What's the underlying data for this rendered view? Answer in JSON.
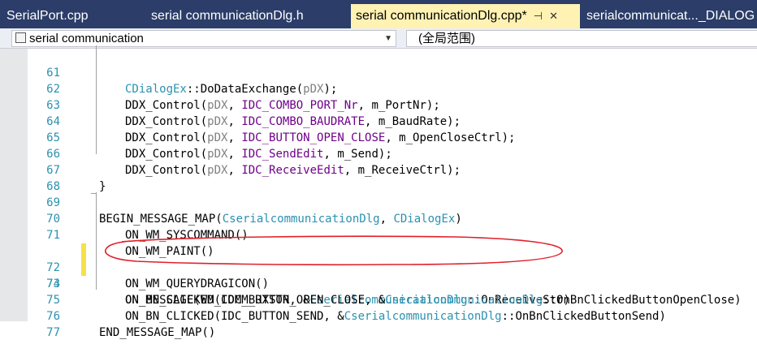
{
  "tabs": [
    {
      "label": "SerialPort.cpp",
      "active": false
    },
    {
      "label": "serial communicationDlg.h",
      "active": false
    },
    {
      "label": "serial communicationDlg.cpp*",
      "active": true
    },
    {
      "label": "serialcommunicat..._DIALOG",
      "active": false
    }
  ],
  "dropdowns": {
    "project_label": "serial communication",
    "scope_label": "(全局范围)"
  },
  "lines": {
    "n61": "61",
    "n62": "62",
    "n63": "63",
    "n64": "64",
    "n65": "65",
    "n66": "66",
    "n67": "67",
    "n68": "68",
    "n69": "69",
    "n70": "70",
    "n71": "71",
    "n72": "72",
    "n73": "73",
    "n74": "74",
    "n75": "75",
    "n76": "76",
    "n77": "77"
  },
  "code": {
    "cdialogex": "CDialogEx",
    "dodataexchange": "::DoDataExchange(",
    "pdx": "pDX",
    "close1": ");",
    "ddx": "DDX_Control(",
    "comma": ", ",
    "id_port": "IDC_COMBO_PORT_Nr",
    "v_port": ", m_PortNr);",
    "id_baud": "IDC_COMBO_BAUDRATE",
    "v_baud": ", m_BaudRate);",
    "id_open": "IDC_BUTTON_OPEN_CLOSE",
    "v_open": ", m_OpenCloseCtrl);",
    "id_send": "IDC_SendEdit",
    "v_send": ", m_Send);",
    "id_recv": "IDC_ReceiveEdit",
    "v_recv": ", m_ReceiveCtrl);",
    "brace_close": "}",
    "begin": "BEGIN_MESSAGE_MAP(",
    "cdlg": "CserialcommunicationDlg",
    "sep": ", ",
    "cdialogex2": "CDialogEx",
    "rparen": ")",
    "syscmd": "ON_WM_SYSCOMMAND()",
    "paint": "ON_WM_PAINT()",
    "querydrag": "ON_WM_QUERYDRAGICON()",
    "onmsg": "ON_MESSAGE(WM_COMM_RXSTR, &",
    "cdlg2": "CserialcommunicationDlg",
    "onrecv": "::OnReceiveStr)",
    "onbn1": "ON_BN_CLICKED(IDC_BUTTON_OPEN_CLOSE, &",
    "cdlg3": "CserialcommunicationDlg",
    "onbn1b": "::OnBnClickedButtonOpenClose)",
    "onbn2": "ON_BN_CLICKED(IDC_BUTTON_SEND, &",
    "cdlg4": "CserialcommunicationDlg",
    "onbn2b": "::OnBnClickedButtonSend)",
    "end": "END_MESSAGE_MAP()"
  },
  "colors": {
    "tabbar": "#2b3d68",
    "active_tab": "#fff2b3",
    "line_number": "#2b91af",
    "class_name": "#2b91af",
    "macro_id": "#6f008a",
    "parameter": "#808080",
    "change_marker": "#f5e14b",
    "annotation": "#e0202a"
  },
  "icons": {
    "pin": "pin-icon",
    "close": "close-icon",
    "project": "project-icon",
    "dropdown": "chevron-down-icon"
  }
}
